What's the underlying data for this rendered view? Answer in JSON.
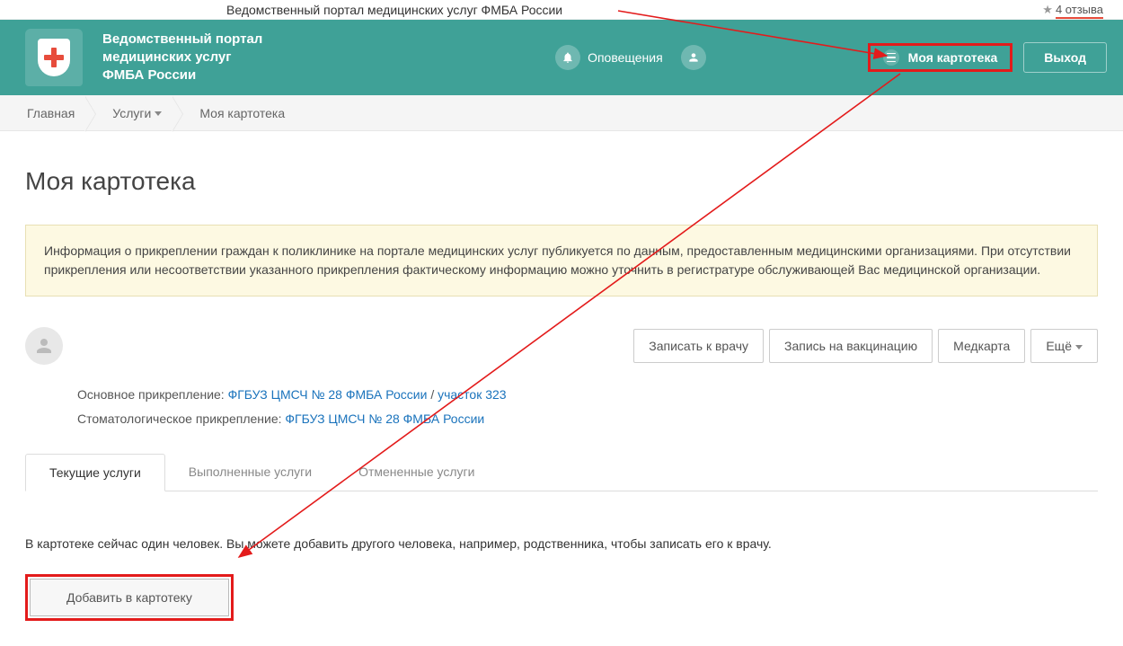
{
  "topStrip": {
    "label": "Ведомственный портал медицинских услуг ФМБА России",
    "reviews": "4 отзыва"
  },
  "header": {
    "title_line1": "Ведомственный портал",
    "title_line2": "медицинских услуг",
    "title_line3": "ФМБА России",
    "notifications": "Оповещения",
    "myKartoteka": "Моя картотека",
    "exit": "Выход"
  },
  "breadcrumbs": {
    "home": "Главная",
    "services": "Услуги",
    "current": "Моя картотека"
  },
  "page": {
    "title": "Моя картотека",
    "info": "Информация о прикреплении граждан к поликлинике на портале медицинских услуг публикуется по данным, предоставленным медицинскими организациями. При отсутствии прикрепления или несоответствии указанного прикрепления фактическому информацию можно уточнить в регистратуре обслуживающей Вас медицинской организации.",
    "actions": {
      "appoint": "Записать к врачу",
      "vaccine": "Запись на вакцинацию",
      "medcard": "Медкарта",
      "more": "Ещё"
    },
    "attachment": {
      "mainLabel": "Основное прикрепление:",
      "mainOrg": "ФГБУЗ ЦМСЧ № 28 ФМБА России",
      "mainSector": "участок 323",
      "dentalLabel": "Стоматологическое прикрепление:",
      "dentalOrg": "ФГБУЗ ЦМСЧ № 28 ФМБА России"
    },
    "tabs": {
      "current": "Текущие услуги",
      "done": "Выполненные услуги",
      "cancelled": "Отмененные услуги"
    },
    "bottomText": "В картотеке сейчас один человек. Вы можете добавить другого человека, например, родственника, чтобы записать его к врачу.",
    "addBtn": "Добавить в картотеку"
  }
}
